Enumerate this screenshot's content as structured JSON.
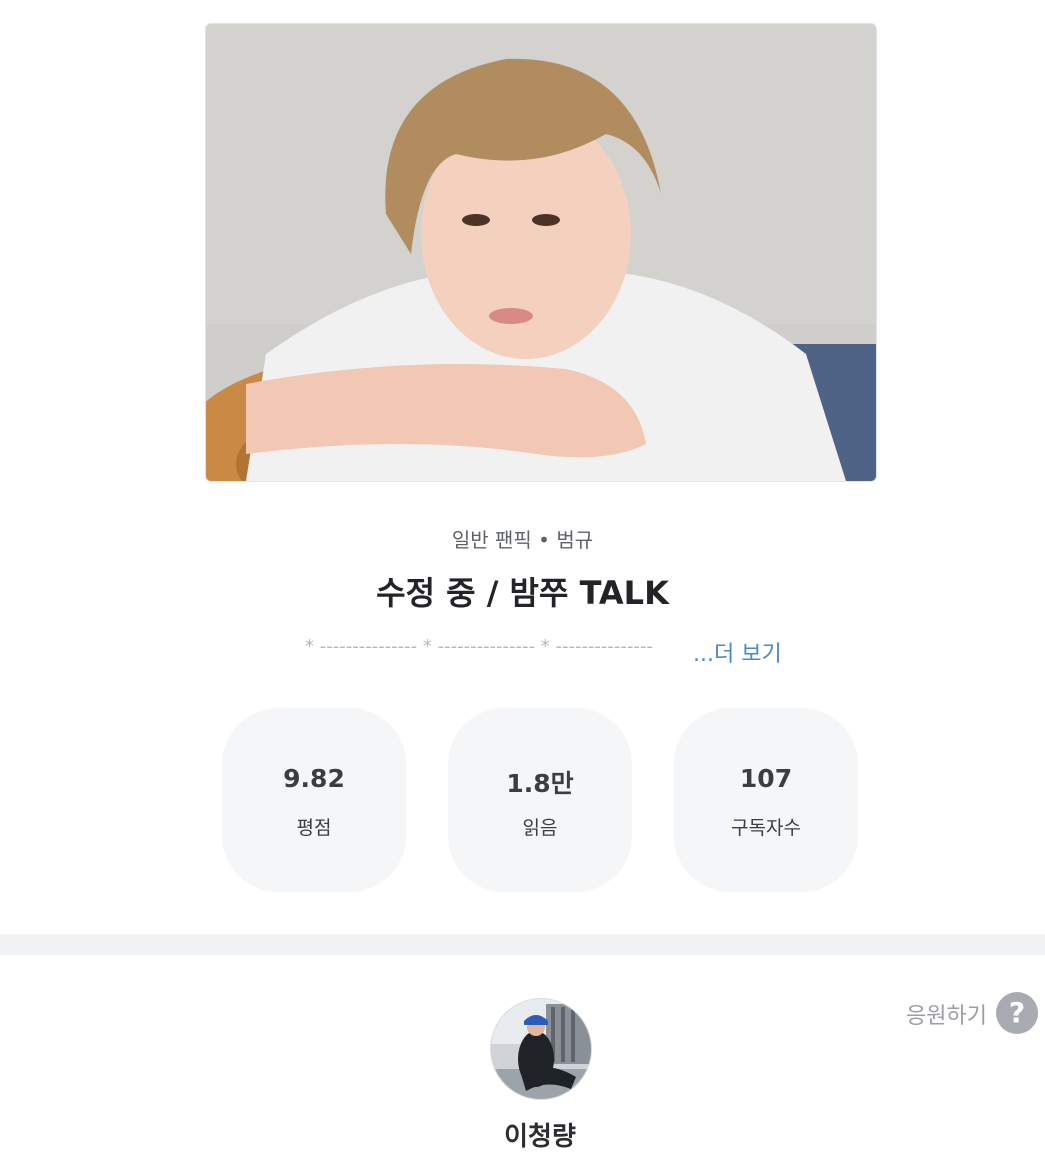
{
  "cover": {
    "alt": "작품 표지"
  },
  "info": {
    "genre": "일반 팬픽 • 범규",
    "title": "수정 중 / 밤쭈 TALK",
    "description_preview": "* --------------- * --------------- * ---------------",
    "more_label": "...더 보기"
  },
  "stats": [
    {
      "value": "9.82",
      "label": "평점"
    },
    {
      "value": "1.8만",
      "label": "읽음"
    },
    {
      "value": "107",
      "label": "구독자수"
    }
  ],
  "support": {
    "label": "응원하기",
    "help_icon": "?"
  },
  "author": {
    "name": "이청량"
  },
  "colors": {
    "link": "#4a89c8",
    "stat_bg": "#f5f6f8",
    "divider": "#f1f2f4",
    "help_icon_bg": "#a8acb2"
  }
}
